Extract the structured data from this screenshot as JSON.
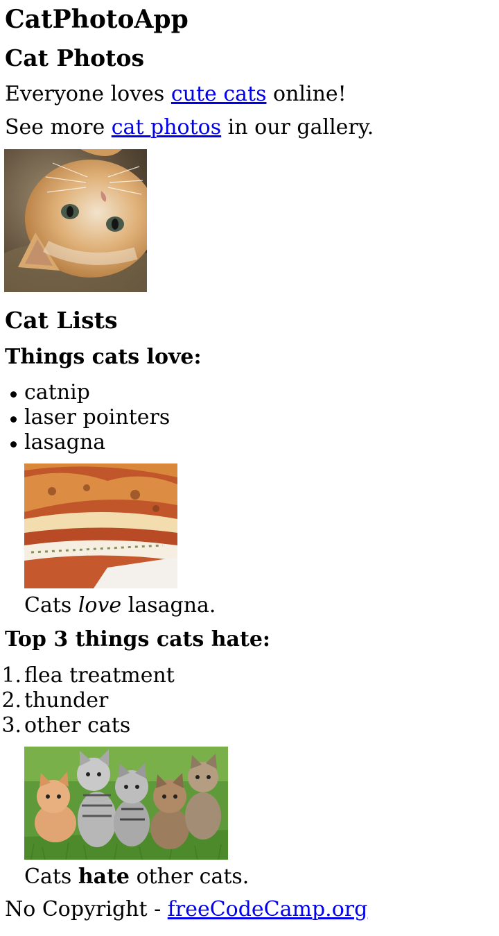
{
  "app": {
    "title": "CatPhotoApp"
  },
  "photos_section": {
    "title": "Cat Photos",
    "line1": {
      "before": "Everyone loves ",
      "link": "cute cats",
      "after": " online!"
    },
    "line2": {
      "before": "See more ",
      "link": "cat photos",
      "after": " in our gallery."
    }
  },
  "lists_section": {
    "title": "Cat Lists",
    "loves": {
      "heading": "Things cats love:",
      "items": [
        "catnip",
        "laser pointers",
        "lasagna"
      ],
      "caption": {
        "before": "Cats ",
        "emphasis": "love",
        "after": " lasagna."
      }
    },
    "hates": {
      "heading": "Top 3 things cats hate:",
      "items": [
        "flea treatment",
        "thunder",
        "other cats"
      ],
      "numbers": [
        "1.",
        "2.",
        "3."
      ],
      "caption": {
        "before": "Cats ",
        "strong": "hate",
        "after": " other cats."
      }
    }
  },
  "footer": {
    "before": "No Copyright - ",
    "link": "freeCodeCamp.org"
  }
}
